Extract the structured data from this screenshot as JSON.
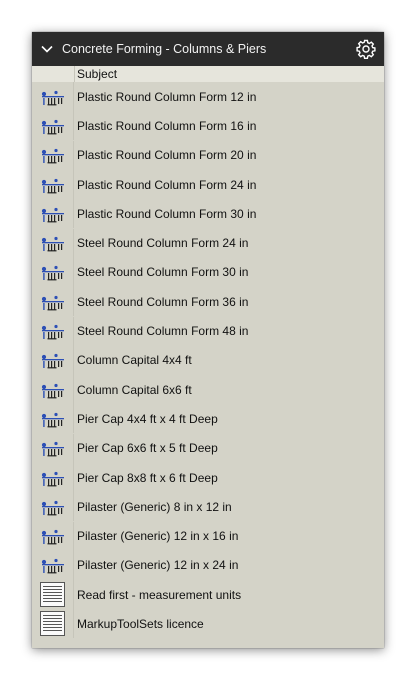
{
  "header": {
    "title": "Concrete Forming - Columns & Piers",
    "collapse_icon": "chevron-down-icon",
    "settings_icon": "gear-icon"
  },
  "columns": {
    "subject": "Subject"
  },
  "items": [
    {
      "label": "Plastic Round Column Form 12 in",
      "icon": "column-form-icon"
    },
    {
      "label": "Plastic Round Column Form 16 in",
      "icon": "column-form-icon"
    },
    {
      "label": "Plastic Round Column Form 20 in",
      "icon": "column-form-icon"
    },
    {
      "label": "Plastic Round Column Form 24 in",
      "icon": "column-form-icon"
    },
    {
      "label": "Plastic Round Column Form 30 in",
      "icon": "column-form-icon"
    },
    {
      "label": "Steel Round Column Form 24 in",
      "icon": "column-form-icon"
    },
    {
      "label": "Steel Round Column Form 30 in",
      "icon": "column-form-icon"
    },
    {
      "label": "Steel Round Column Form 36 in",
      "icon": "column-form-icon"
    },
    {
      "label": "Steel Round Column Form 48 in",
      "icon": "column-form-icon"
    },
    {
      "label": "Column Capital 4x4 ft",
      "icon": "column-form-icon"
    },
    {
      "label": "Column Capital 6x6 ft",
      "icon": "column-form-icon"
    },
    {
      "label": "Pier Cap 4x4 ft x 4 ft Deep",
      "icon": "column-form-icon"
    },
    {
      "label": "Pier Cap 6x6 ft x 5 ft Deep",
      "icon": "column-form-icon"
    },
    {
      "label": "Pier Cap 8x8 ft x 6 ft Deep",
      "icon": "column-form-icon"
    },
    {
      "label": "Pilaster (Generic) 8 in x 12 in",
      "icon": "column-form-icon"
    },
    {
      "label": "Pilaster (Generic) 12 in x 16 in",
      "icon": "column-form-icon"
    },
    {
      "label": "Pilaster (Generic) 12 in x 24 in",
      "icon": "column-form-icon"
    },
    {
      "label": "Read first - measurement units",
      "icon": "document-icon"
    },
    {
      "label": "MarkupToolSets licence",
      "icon": "document-icon"
    }
  ],
  "colors": {
    "header_bg": "#2b2b2b",
    "panel_bg": "#d4d3c8",
    "icon_blue": "#2c4fb5"
  }
}
